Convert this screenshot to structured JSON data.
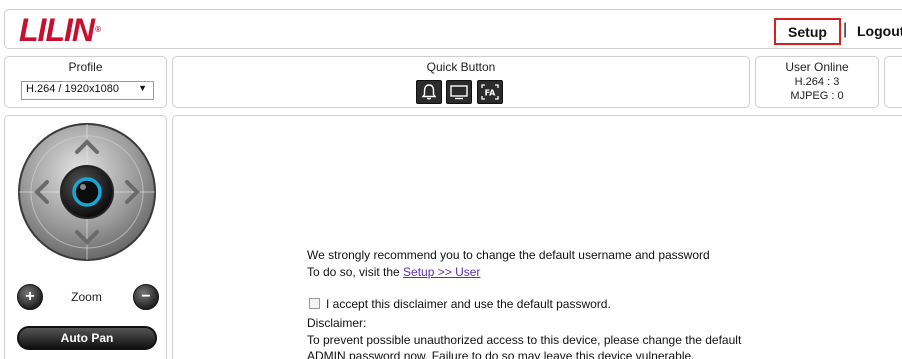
{
  "header": {
    "logo_text": "LILIN",
    "logo_mark": "®",
    "setup_label": "Setup",
    "separator": "|",
    "logout_label": "Logout"
  },
  "profile": {
    "title": "Profile",
    "selected": "H.264 / 1920x1080"
  },
  "quick": {
    "title": "Quick Button",
    "buttons": [
      {
        "icon": "bell-icon"
      },
      {
        "icon": "display-icon"
      },
      {
        "icon": "focus-area-icon"
      }
    ]
  },
  "users": {
    "title": "User Online",
    "h264": "H.264 : 3",
    "mjpeg": "MJPEG : 0"
  },
  "ptz": {
    "zoom_label": "Zoom",
    "autopan_label": "Auto Pan"
  },
  "notice": {
    "line1": "We strongly recommend you to change the default username and password",
    "line2_prefix": "To do so, visit the ",
    "line2_link": "Setup >> User",
    "accept_label": "I accept this disclaimer and use the default password.",
    "disclaimer_title": "Disclaimer:",
    "disclaimer_line1": "To prevent possible unauthorized access to this device, please change the default",
    "disclaimer_line2": "ADMIN password now. Failure to do so may leave this device vulnerable."
  },
  "colors": {
    "brand_red": "#c8102e",
    "setup_border": "#d61f1f",
    "link": "#5b2fb3",
    "joystick_ring": "#1aa6d8"
  }
}
